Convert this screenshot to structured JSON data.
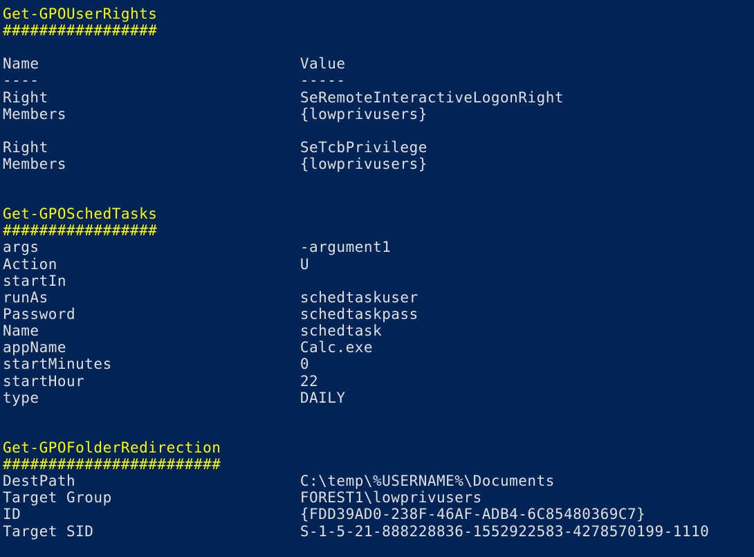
{
  "sections": {
    "userRights": {
      "title": "Get-GPOUserRights",
      "hashes": "#################",
      "header": {
        "name": "Name",
        "value": "Value"
      },
      "divider": {
        "name": "----",
        "value": "-----"
      },
      "rows1": [
        {
          "name": "Right",
          "value": "SeRemoteInteractiveLogonRight"
        },
        {
          "name": "Members",
          "value": "{lowprivusers}"
        }
      ],
      "rows2": [
        {
          "name": "Right",
          "value": "SeTcbPrivilege"
        },
        {
          "name": "Members",
          "value": "{lowprivusers}"
        }
      ]
    },
    "schedTasks": {
      "title": "Get-GPOSchedTasks",
      "hashes": "#################",
      "rows": [
        {
          "name": "args",
          "value": "-argument1"
        },
        {
          "name": "Action",
          "value": "U"
        },
        {
          "name": "startIn",
          "value": ""
        },
        {
          "name": "runAs",
          "value": "schedtaskuser"
        },
        {
          "name": "Password",
          "value": "schedtaskpass"
        },
        {
          "name": "Name",
          "value": "schedtask"
        },
        {
          "name": "appName",
          "value": "Calc.exe"
        },
        {
          "name": "startMinutes",
          "value": "0"
        },
        {
          "name": "startHour",
          "value": "22"
        },
        {
          "name": "type",
          "value": "DAILY"
        }
      ]
    },
    "folderRedirection": {
      "title": "Get-GPOFolderRedirection",
      "hashes": "########################",
      "rows": [
        {
          "name": "DestPath",
          "value": "C:\\temp\\%USERNAME%\\Documents"
        },
        {
          "name": "Target Group",
          "value": "FOREST1\\lowprivusers"
        },
        {
          "name": "ID",
          "value": "{FDD39AD0-238F-46AF-ADB4-6C85480369C7}"
        },
        {
          "name": "Target SID",
          "value": "S-1-5-21-888228836-1552922583-4278570199-1110"
        }
      ]
    }
  }
}
